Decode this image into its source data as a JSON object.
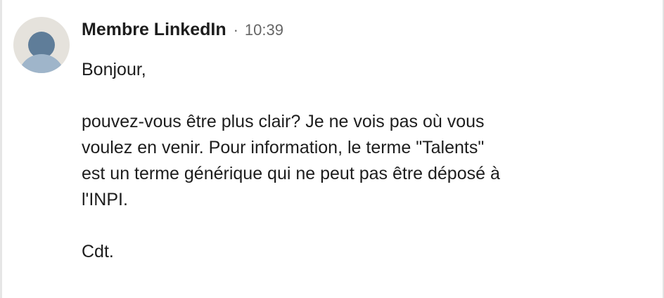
{
  "message": {
    "sender": "Membre LinkedIn",
    "separator": "·",
    "time": "10:39",
    "avatar_icon": "default-person-avatar-icon",
    "greeting": "Bonjour,",
    "body_line1": "pouvez-vous être plus clair? Je ne vois pas où vous",
    "body_line2": "voulez en venir. Pour information, le terme \"Talents\"",
    "body_line3": "est un terme générique qui ne peut pas être déposé à",
    "body_line4": "l'INPI.",
    "signoff": "Cdt."
  },
  "colors": {
    "text": "#1d1d1d",
    "muted": "#666666",
    "avatar_bg": "#e5e2dc",
    "avatar_head": "#5f7d99",
    "avatar_body": "#9fb5ca"
  }
}
